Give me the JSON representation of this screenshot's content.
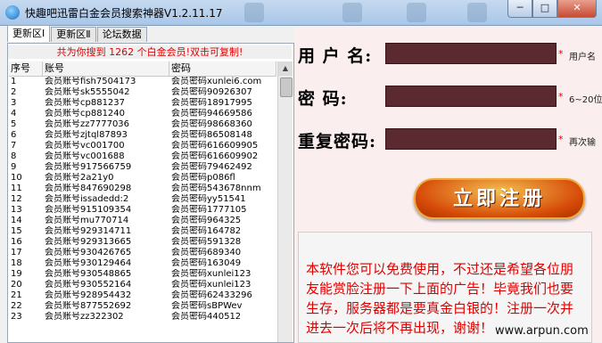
{
  "window": {
    "title": "快趣吧迅雷白金会员搜索神器V1.2.11.17",
    "min_label": "─",
    "max_label": "□",
    "close_label": "✕"
  },
  "tabs": [
    "更新区Ⅰ",
    "更新区Ⅱ",
    "论坛数据"
  ],
  "banner": "共为你搜到 1262 个白金会员!双击可复制!",
  "table": {
    "headers": [
      "序号",
      "账号",
      "密码"
    ],
    "rows": [
      [
        "1",
        "会员账号fish7504173",
        "会员密码xunlei6.com"
      ],
      [
        "2",
        "会员账号sk5555042",
        "会员密码90926307"
      ],
      [
        "3",
        "会员账号cp881237",
        "会员密码18917995"
      ],
      [
        "4",
        "会员账号cp881240",
        "会员密码94669586"
      ],
      [
        "5",
        "会员账号zz7777036",
        "会员密码98668360"
      ],
      [
        "6",
        "会员账号zjtql87893",
        "会员密码86508148"
      ],
      [
        "7",
        "会员账号vc001700",
        "会员密码616609905"
      ],
      [
        "8",
        "会员账号vc001688",
        "会员密码616609902"
      ],
      [
        "9",
        "会员账号917566759",
        "会员密码79462492"
      ],
      [
        "10",
        "会员账号2a21y0",
        "会员密码p086fl"
      ],
      [
        "11",
        "会员账号847690298",
        "会员密码543678nnm"
      ],
      [
        "12",
        "会员账号issadedd:2",
        "会员密码yy51541"
      ],
      [
        "13",
        "会员账号915109354",
        "会员密码1777105"
      ],
      [
        "14",
        "会员账号mu770714",
        "会员密码964325"
      ],
      [
        "15",
        "会员账号929314711",
        "会员密码164782"
      ],
      [
        "16",
        "会员账号929313665",
        "会员密码591328"
      ],
      [
        "17",
        "会员账号930426765",
        "会员密码689340"
      ],
      [
        "18",
        "会员账号930129464",
        "会员密码163049"
      ],
      [
        "19",
        "会员账号930548865",
        "会员密码xunlei123"
      ],
      [
        "20",
        "会员账号930552164",
        "会员密码xunlei123"
      ],
      [
        "21",
        "会员账号928954432",
        "会员密码62433296"
      ],
      [
        "22",
        "会员账号877552692",
        "会员密码sBPWev"
      ],
      [
        "23",
        "会员账号zz322302",
        "会员密码440512"
      ]
    ]
  },
  "form": {
    "username_label": "用 户 名:",
    "password_label": "密   码:",
    "confirm_label": "重复密码:",
    "required_mark": "*",
    "username_hint": "用户名",
    "password_hint": "6~20位",
    "confirm_hint": "再次输",
    "register_button": "立即注册"
  },
  "notice": "本软件您可以免费使用，不过还是希望各位朋友能赏脸注册一下上面的广告！毕竟我们也要生存，服务器都是要真金白银的！注册一次并进去一次后将不再出现，谢谢！",
  "watermark": "www.arpun.com"
}
